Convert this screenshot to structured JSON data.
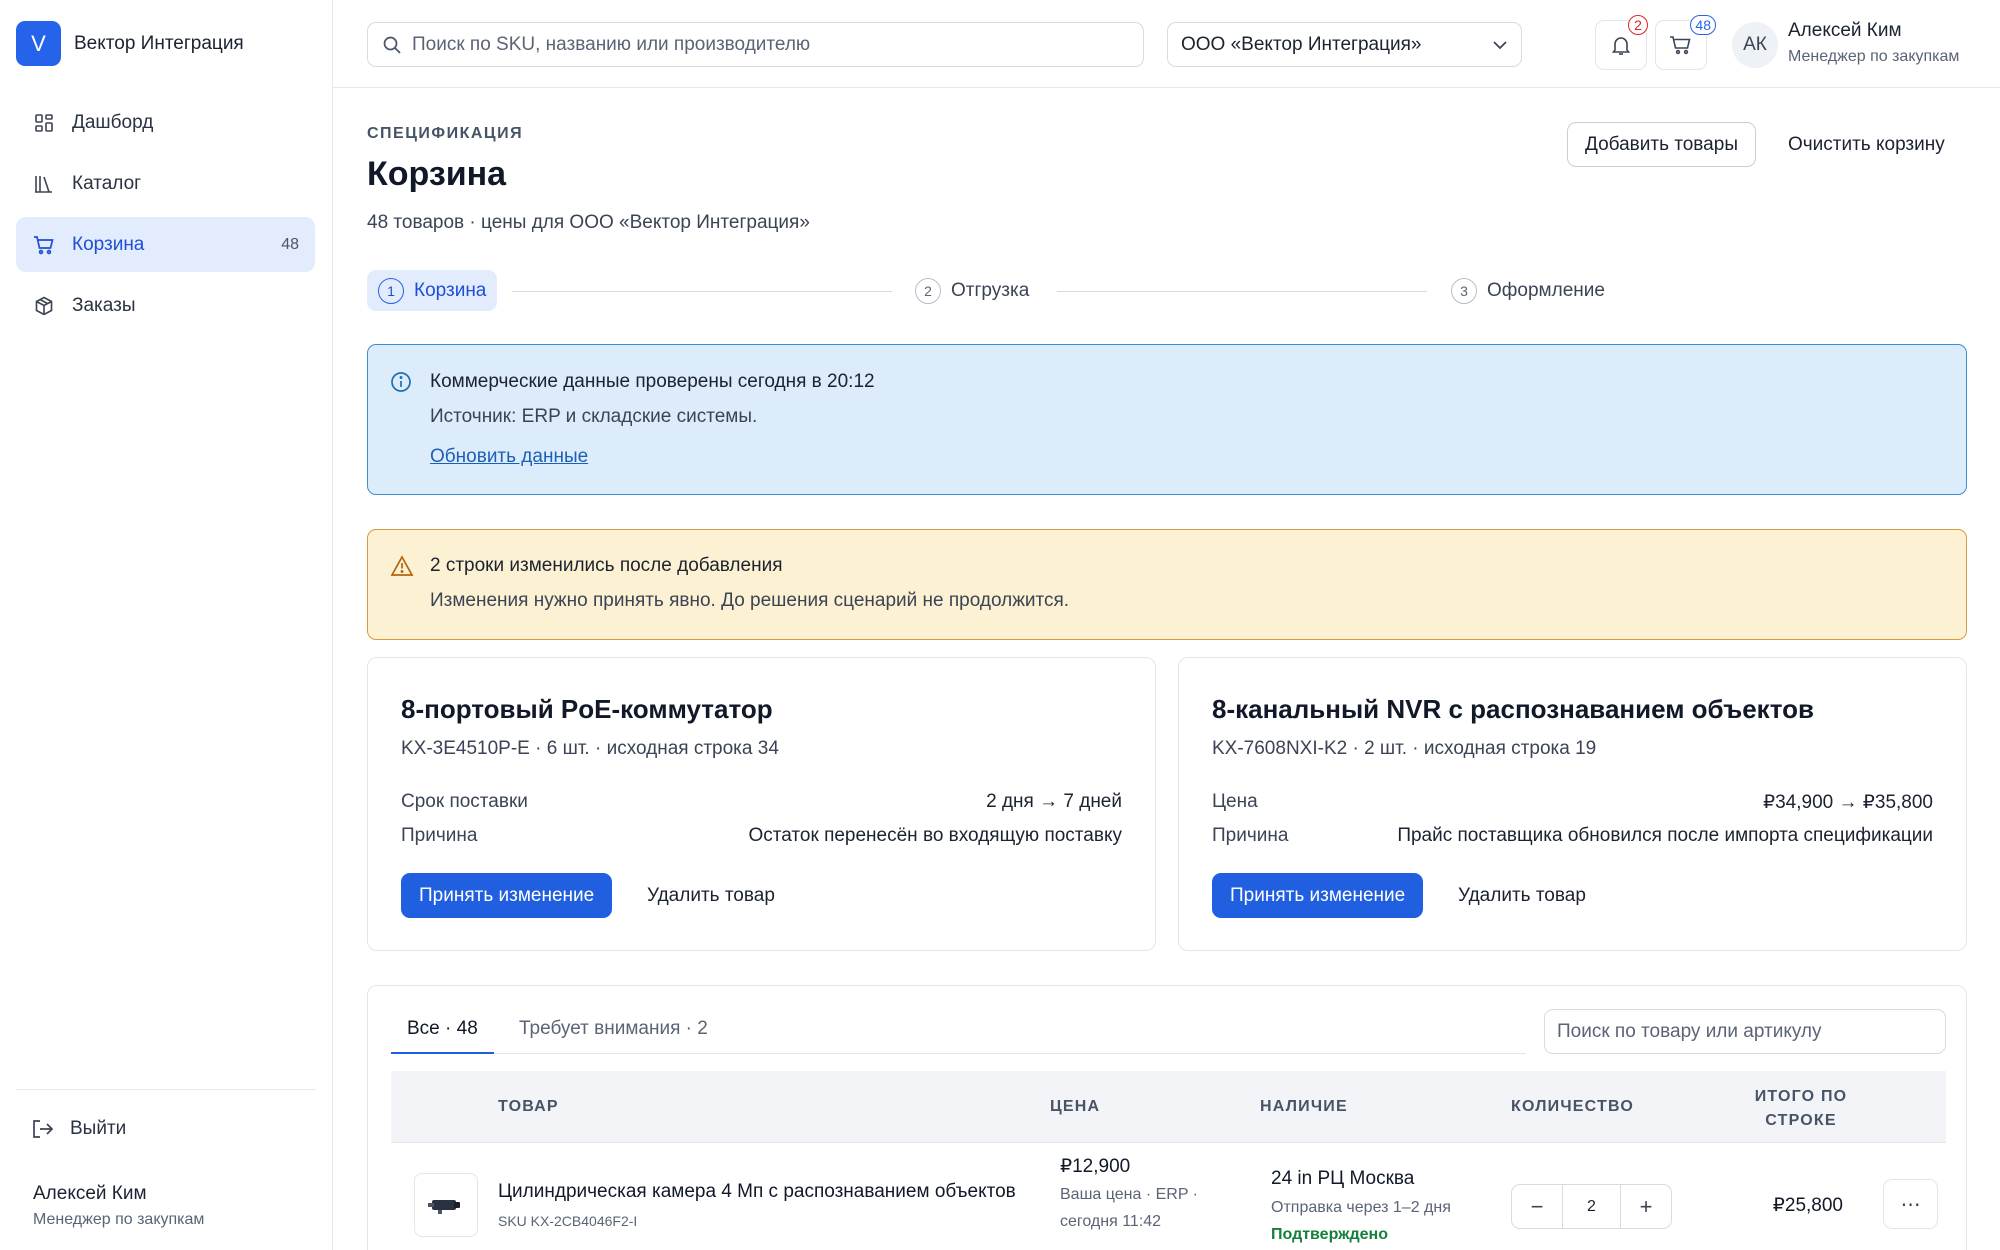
{
  "sidebar": {
    "brand_initial": "V",
    "brand_name": "Вектор Интеграция",
    "items": [
      {
        "label": "Дашборд",
        "icon": "grid-icon"
      },
      {
        "label": "Каталог",
        "icon": "library-icon"
      },
      {
        "label": "Корзина",
        "icon": "cart-icon",
        "count": "48"
      },
      {
        "label": "Заказы",
        "icon": "box-icon"
      }
    ],
    "logout_label": "Выйти",
    "user_name": "Алексей Ким",
    "user_role": "Менеджер по закупкам"
  },
  "topbar": {
    "search_placeholder": "Поиск по SKU, названию или производителю",
    "org_selected": "ООО «Вектор Интеграция»",
    "notifications_count": "2",
    "cart_count": "48",
    "avatar_initials": "АК",
    "user_name": "Алексей Ким",
    "user_role": "Менеджер по закупкам"
  },
  "header": {
    "eyebrow": "СПЕЦИФИКАЦИЯ",
    "title": "Корзина",
    "subtitle": "48 товаров · цены для ООО «Вектор Интеграция»",
    "add_button": "Добавить товары",
    "clear_button": "Очистить корзину"
  },
  "stepper": [
    {
      "num": "1",
      "label": "Корзина"
    },
    {
      "num": "2",
      "label": "Отгрузка"
    },
    {
      "num": "3",
      "label": "Оформление"
    }
  ],
  "info": {
    "title": "Коммерческие данные проверены сегодня в 20:12",
    "source": "Источник: ERP и складские системы.",
    "link": "Обновить данные"
  },
  "warning": {
    "title": "2 строки изменились после добавления",
    "text": "Изменения нужно принять явно. До решения сценарий не продолжится."
  },
  "changes": [
    {
      "title": "8-портовый PoE-коммутатор",
      "meta": "KX-3E4510P-E · 6 шт. · исходная строка 34",
      "rows": [
        {
          "key": "Срок поставки",
          "value": "2 дня → 7 дней"
        },
        {
          "key": "Причина",
          "value": "Остаток перенесён во входящую поставку"
        }
      ],
      "accept": "Принять изменение",
      "remove": "Удалить товар"
    },
    {
      "title": "8-канальный NVR с распознаванием объектов",
      "meta": "KX-7608NXI-K2 · 2 шт. · исходная строка 19",
      "rows": [
        {
          "key": "Цена",
          "value": "₽34,900 → ₽35,800"
        },
        {
          "key": "Причина",
          "value": "Прайс поставщика обновился после импорта спецификации"
        }
      ],
      "accept": "Принять изменение",
      "remove": "Удалить товар"
    }
  ],
  "table": {
    "tabs": [
      {
        "label": "Все · 48"
      },
      {
        "label": "Требует внимания · 2"
      }
    ],
    "search_placeholder": "Поиск по товару или артикулу",
    "columns": {
      "product": "ТОВАР",
      "price": "ЦЕНА",
      "stock": "НАЛИЧИЕ",
      "qty": "КОЛИЧЕСТВО",
      "total_line1": "ИТОГО ПО",
      "total_line2": "СТРОКЕ"
    },
    "rows": [
      {
        "name": "Цилиндрическая камера 4 Мп с распознаванием объектов",
        "sku": "SKU KX-2CB4046F2-I",
        "price": "₽12,900",
        "price_note_1": "Ваша цена · ERP ·",
        "price_note_2": "сегодня 11:42",
        "stock": "24 in РЦ Москва",
        "stock_note": "Отправка через 1–2 дня",
        "stock_status": "Подтверждено",
        "qty": "2",
        "total": "₽25,800"
      }
    ]
  },
  "colors": {
    "accent": "#1f5fe0",
    "info_bg": "#dcecfa",
    "warn_bg": "#fdf1d3",
    "confirmed": "#15803d"
  }
}
